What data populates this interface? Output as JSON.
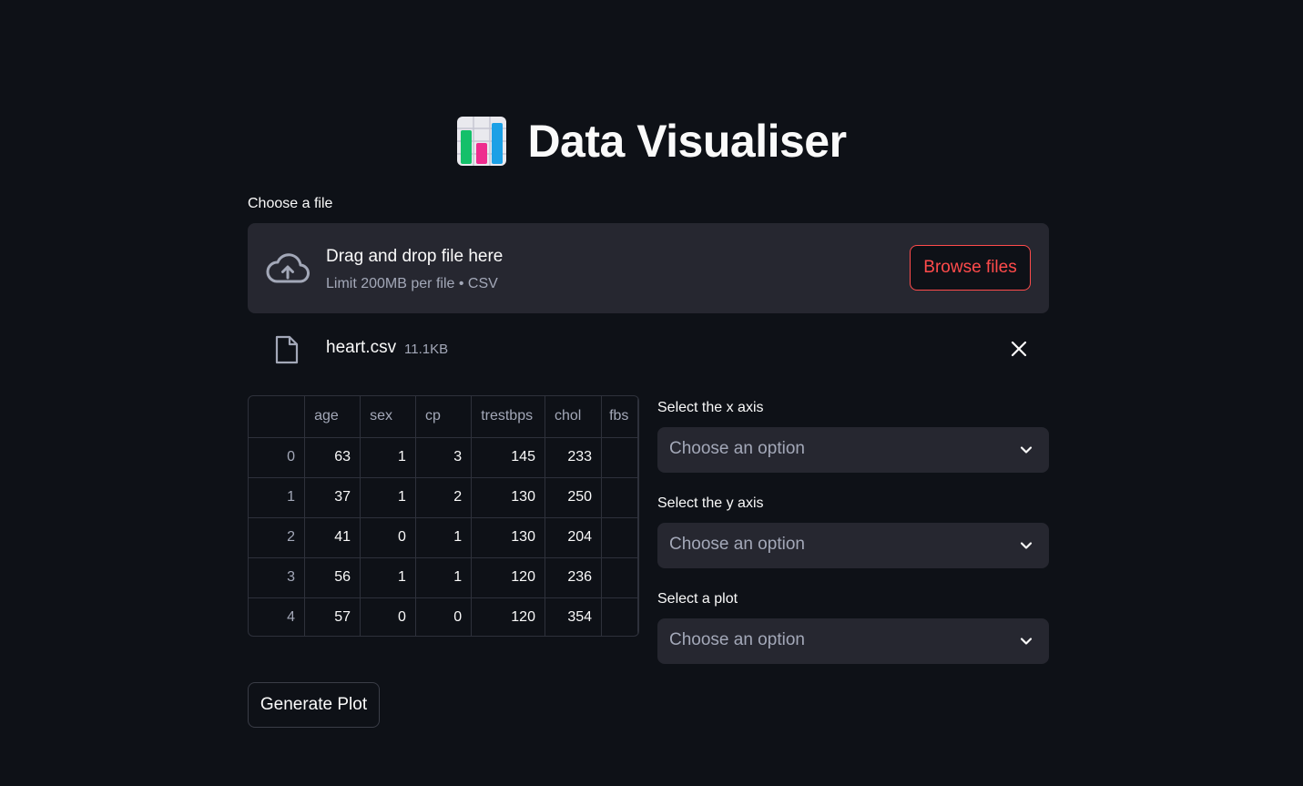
{
  "header": {
    "icon": "bar-chart-icon",
    "title": "Data Visualiser"
  },
  "uploader": {
    "label": "Choose a file",
    "drop_title": "Drag and drop file here",
    "drop_subtitle": "Limit 200MB per file • CSV",
    "browse_label": "Browse files",
    "icon": "cloud-upload-icon"
  },
  "uploaded_file": {
    "name": "heart.csv",
    "size": "11.1KB",
    "icon": "file-icon"
  },
  "dataframe": {
    "columns": [
      "",
      "age",
      "sex",
      "cp",
      "trestbps",
      "chol",
      "fbs"
    ],
    "rows": [
      [
        "0",
        "63",
        "1",
        "3",
        "145",
        "233",
        ""
      ],
      [
        "1",
        "37",
        "1",
        "2",
        "130",
        "250",
        ""
      ],
      [
        "2",
        "41",
        "0",
        "1",
        "130",
        "204",
        ""
      ],
      [
        "3",
        "56",
        "1",
        "1",
        "120",
        "236",
        ""
      ],
      [
        "4",
        "57",
        "0",
        "0",
        "120",
        "354",
        ""
      ]
    ]
  },
  "selects": {
    "x_axis": {
      "label": "Select the x axis",
      "value": "Choose an option"
    },
    "y_axis": {
      "label": "Select the y axis",
      "value": "Choose an option"
    },
    "plot": {
      "label": "Select a plot",
      "value": "Choose an option"
    }
  },
  "actions": {
    "generate_label": "Generate Plot"
  },
  "colors": {
    "background": "#0e1117",
    "surface": "#262730",
    "accent": "#ff4b4b",
    "muted_text": "#a3a8b8"
  }
}
